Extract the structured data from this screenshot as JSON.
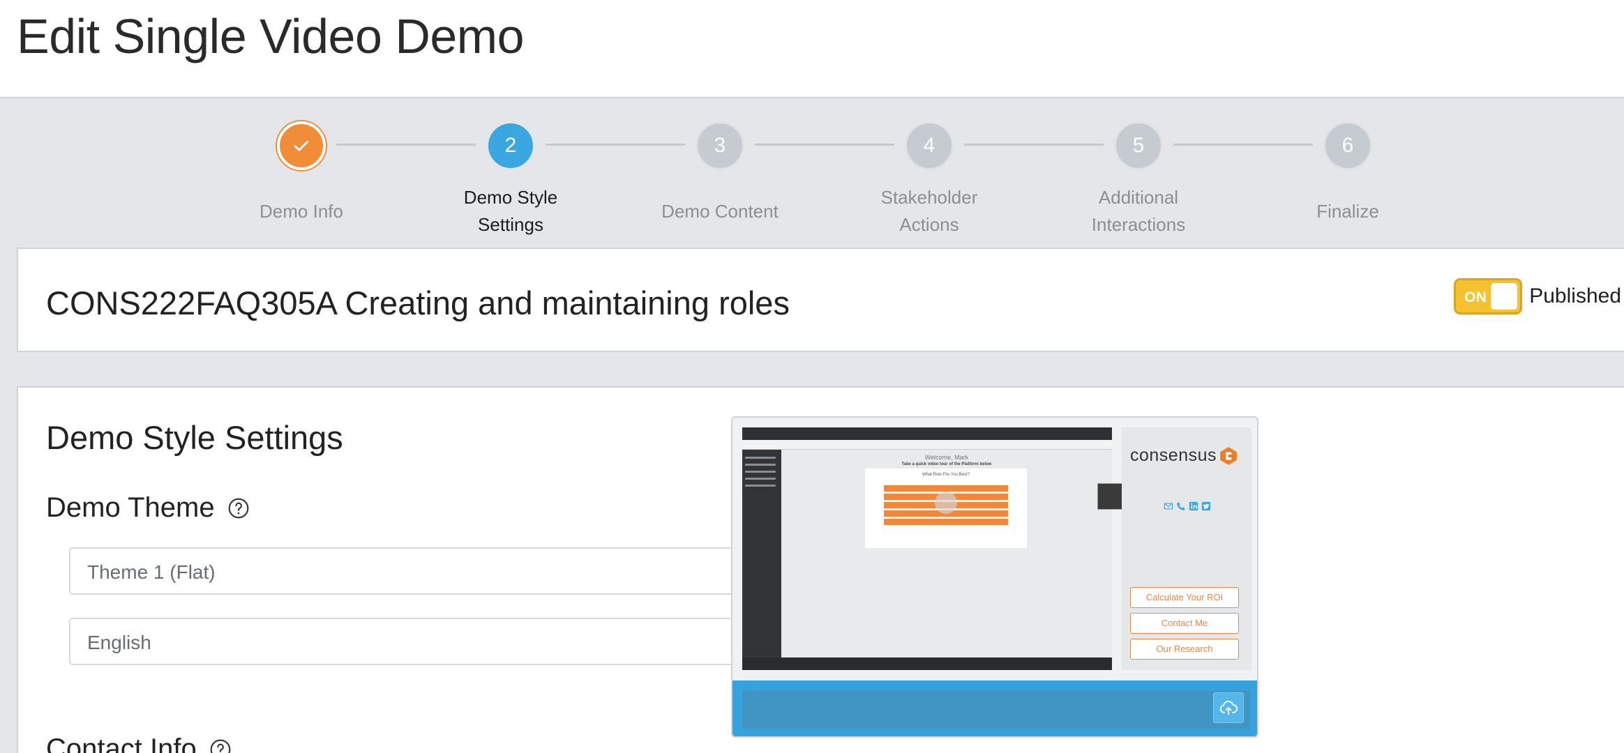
{
  "page": {
    "title": "Edit Single Video Demo"
  },
  "stepper": {
    "steps": [
      {
        "number": "",
        "label": "Demo Info",
        "state": "done"
      },
      {
        "number": "2",
        "label": "Demo Style Settings",
        "state": "active"
      },
      {
        "number": "3",
        "label": "Demo Content",
        "state": "pending"
      },
      {
        "number": "4",
        "label": "Stakeholder Actions",
        "state": "pending"
      },
      {
        "number": "5",
        "label": "Additional Interactions",
        "state": "pending"
      },
      {
        "number": "6",
        "label": "Finalize",
        "state": "pending"
      }
    ],
    "done_icon": "check-icon"
  },
  "demo": {
    "name": "CONS222FAQ305A Creating and maintaining roles",
    "toggle_text": "ON",
    "toggle_state": true,
    "status_label": "Published"
  },
  "style_settings": {
    "title": "Demo Style Settings",
    "theme_label": "Demo Theme",
    "theme_value": "Theme 1 (Flat)",
    "language_value": "English",
    "contact_label": "Contact Info"
  },
  "preview": {
    "brand": "consensus",
    "video_welcome": "Welcome, Mark",
    "video_subtitle": "Take a quick video tour of the Platform below",
    "video_question": "What Role Fits You Best?",
    "buttons": [
      "Calculate Your ROI",
      "Contact Me",
      "Our Research"
    ],
    "social_icons": [
      "mail-icon",
      "phone-icon",
      "linkedin-icon",
      "twitter-icon"
    ],
    "upload_icon": "cloud-upload-icon"
  },
  "colors": {
    "accent_orange": "#ef8d39",
    "accent_blue": "#3aa7e0",
    "toggle_yellow": "#f6c131",
    "pending_gray": "#c5cbd1"
  }
}
